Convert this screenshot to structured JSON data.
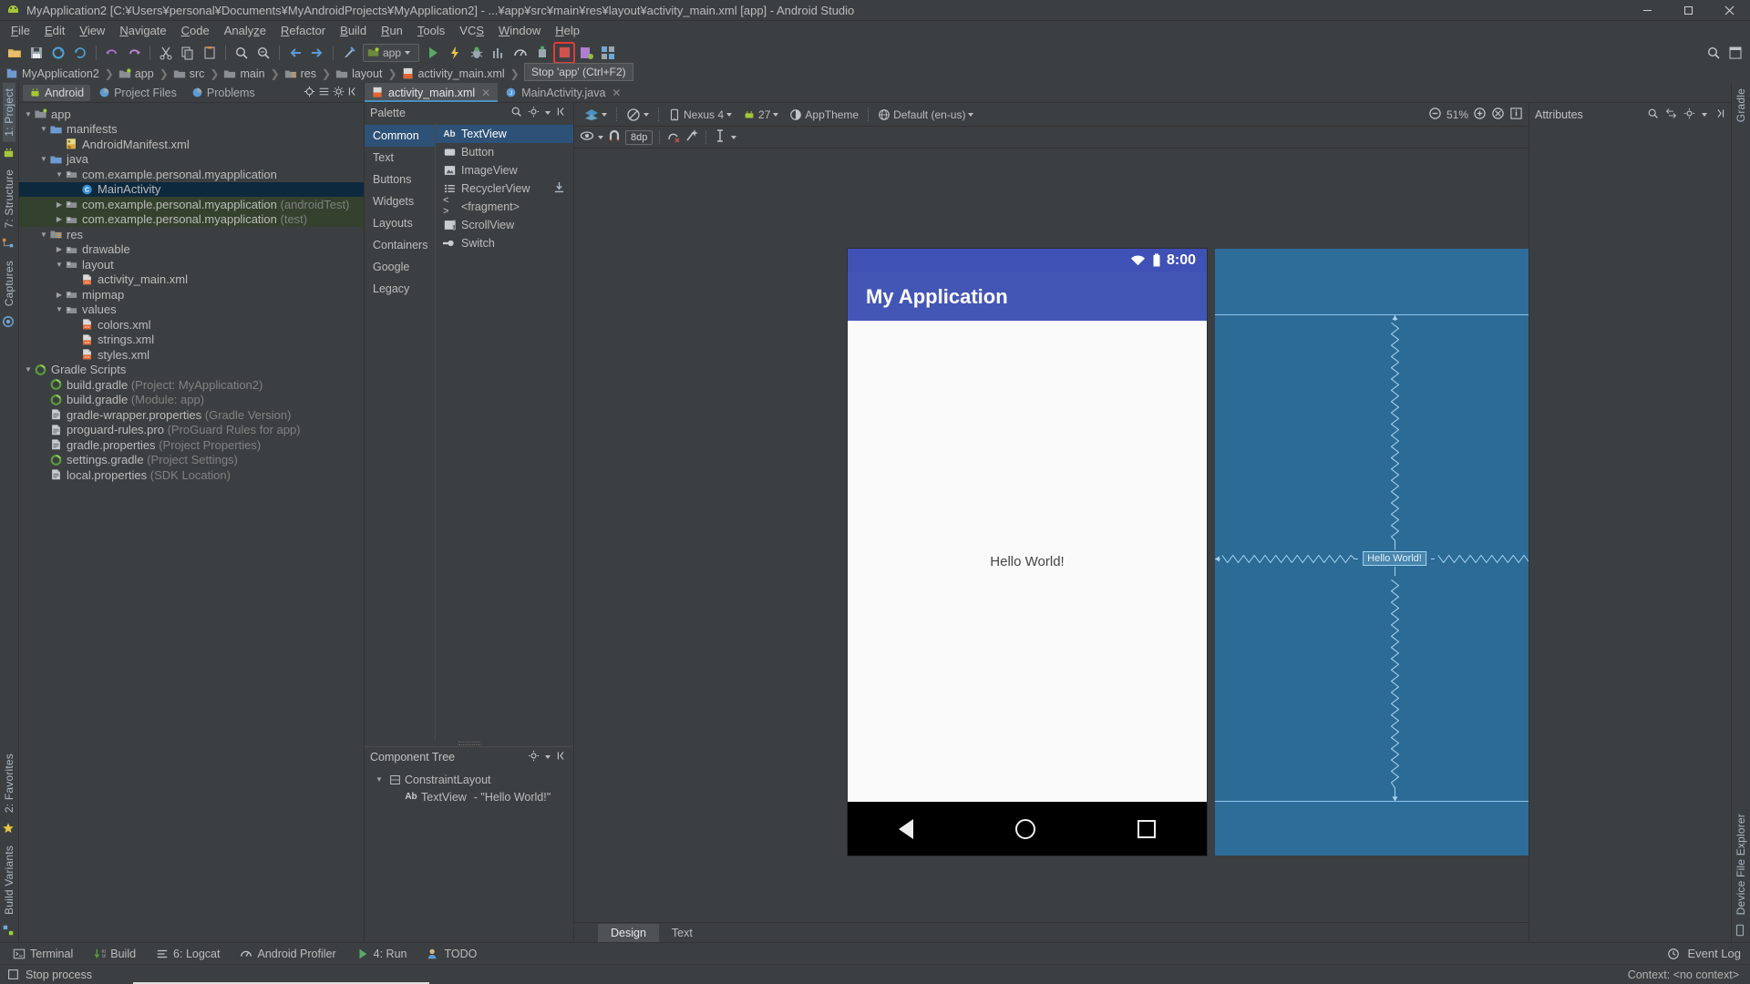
{
  "window": {
    "title": "MyApplication2 [C:¥Users¥personal¥Documents¥MyAndroidProjects¥MyApplication2] - ...¥app¥src¥main¥res¥layout¥activity_main.xml [app] - Android Studio",
    "minimize": "—",
    "maximize": "▢",
    "close": "✕"
  },
  "menu": [
    "File",
    "Edit",
    "View",
    "Navigate",
    "Code",
    "Analyze",
    "Refactor",
    "Build",
    "Run",
    "Tools",
    "VCS",
    "Window",
    "Help"
  ],
  "toolbar": {
    "run_config": "app",
    "tooltip": "Stop 'app' (Ctrl+F2)",
    "icons": [
      "open-folder-icon",
      "save-all-icon",
      "sync-project-icon",
      "refresh-icon",
      "undo-icon",
      "redo-icon",
      "cut-icon",
      "copy-icon",
      "paste-icon",
      "find-icon",
      "replace-icon",
      "back-icon",
      "forward-icon",
      "build-icon",
      "run-icon",
      "apply-changes-icon",
      "debug-icon",
      "profile-icon",
      "attach-debugger-icon",
      "stop-icon",
      "avd-manager-icon",
      "sdk-manager-icon",
      "help-icon"
    ]
  },
  "breadcrumb": [
    "MyApplication2",
    "app",
    "src",
    "main",
    "res",
    "layout",
    "activity_main.xml"
  ],
  "left_strip": {
    "tabs": [
      "1: Project",
      "7: Structure",
      "Captures"
    ],
    "bottom_tabs": [
      "2: Favorites",
      "Build Variants"
    ]
  },
  "right_strip": {
    "tabs": [
      "Gradle",
      "Device File Explorer"
    ]
  },
  "project_panel": {
    "tabs": [
      {
        "label": "Android",
        "icon": "android-icon",
        "active": true
      },
      {
        "label": "Project Files",
        "icon": "project-files-icon",
        "active": false
      },
      {
        "label": "Problems",
        "icon": "problems-icon",
        "active": false
      }
    ],
    "tree": [
      {
        "label": "app",
        "icon": "module-folder-icon",
        "indent": 0,
        "arrow": "down",
        "selected": false
      },
      {
        "label": "manifests",
        "icon": "folder-blue-icon",
        "indent": 1,
        "arrow": "down",
        "selected": false
      },
      {
        "label": "AndroidManifest.xml",
        "icon": "manifest-icon",
        "indent": 2,
        "arrow": "none",
        "selected": false
      },
      {
        "label": "java",
        "icon": "folder-blue-icon",
        "indent": 1,
        "arrow": "down",
        "selected": false
      },
      {
        "label": "com.example.personal.myapplication",
        "icon": "package-icon",
        "indent": 2,
        "arrow": "down",
        "selected": false
      },
      {
        "label": "MainActivity",
        "icon": "class-icon",
        "indent": 3,
        "arrow": "none",
        "selected": true
      },
      {
        "label": "com.example.personal.myapplication",
        "suffix": "(androidTest)",
        "icon": "package-icon",
        "indent": 2,
        "arrow": "right",
        "testbg": true
      },
      {
        "label": "com.example.personal.myapplication",
        "suffix": "(test)",
        "icon": "package-icon",
        "indent": 2,
        "arrow": "right",
        "testbg": true
      },
      {
        "label": "res",
        "icon": "res-folder-icon",
        "indent": 1,
        "arrow": "down",
        "selected": false
      },
      {
        "label": "drawable",
        "icon": "package-icon",
        "indent": 2,
        "arrow": "right",
        "selected": false
      },
      {
        "label": "layout",
        "icon": "package-icon",
        "indent": 2,
        "arrow": "down",
        "selected": false
      },
      {
        "label": "activity_main.xml",
        "icon": "xml-icon",
        "indent": 3,
        "arrow": "none",
        "selected": false
      },
      {
        "label": "mipmap",
        "icon": "package-icon",
        "indent": 2,
        "arrow": "right",
        "selected": false
      },
      {
        "label": "values",
        "icon": "package-icon",
        "indent": 2,
        "arrow": "down",
        "selected": false
      },
      {
        "label": "colors.xml",
        "icon": "xml-icon",
        "indent": 3,
        "arrow": "none",
        "selected": false
      },
      {
        "label": "strings.xml",
        "icon": "xml-icon",
        "indent": 3,
        "arrow": "none",
        "selected": false
      },
      {
        "label": "styles.xml",
        "icon": "xml-icon",
        "indent": 3,
        "arrow": "none",
        "selected": false
      },
      {
        "label": "Gradle Scripts",
        "icon": "gradle-icon",
        "indent": 0,
        "arrow": "down",
        "selected": false
      },
      {
        "label": "build.gradle",
        "suffix": "(Project: MyApplication2)",
        "icon": "gradle-icon",
        "indent": 1,
        "arrow": "none"
      },
      {
        "label": "build.gradle",
        "suffix": "(Module: app)",
        "icon": "gradle-icon",
        "indent": 1,
        "arrow": "none"
      },
      {
        "label": "gradle-wrapper.properties",
        "suffix": "(Gradle Version)",
        "icon": "properties-icon",
        "indent": 1,
        "arrow": "none"
      },
      {
        "label": "proguard-rules.pro",
        "suffix": "(ProGuard Rules for app)",
        "icon": "properties-icon",
        "indent": 1,
        "arrow": "none"
      },
      {
        "label": "gradle.properties",
        "suffix": "(Project Properties)",
        "icon": "properties-icon",
        "indent": 1,
        "arrow": "none"
      },
      {
        "label": "settings.gradle",
        "suffix": "(Project Settings)",
        "icon": "gradle-icon",
        "indent": 1,
        "arrow": "none"
      },
      {
        "label": "local.properties",
        "suffix": "(SDK Location)",
        "icon": "properties-icon",
        "indent": 1,
        "arrow": "none"
      }
    ]
  },
  "editor_tabs": [
    {
      "label": "activity_main.xml",
      "icon": "xml-icon",
      "active": true,
      "close": "✕"
    },
    {
      "label": "MainActivity.java",
      "icon": "java-icon",
      "active": false,
      "close": "✕"
    }
  ],
  "palette": {
    "title": "Palette",
    "categories": [
      "Common",
      "Text",
      "Buttons",
      "Widgets",
      "Layouts",
      "Containers",
      "Google",
      "Legacy"
    ],
    "active_category": "Common",
    "items": [
      {
        "label": "TextView",
        "icon": "ab-icon",
        "active": true,
        "download": false
      },
      {
        "label": "Button",
        "icon": "button-icon",
        "active": false,
        "download": false
      },
      {
        "label": "ImageView",
        "icon": "image-icon",
        "active": false,
        "download": false
      },
      {
        "label": "RecyclerView",
        "icon": "list-icon",
        "active": false,
        "download": true
      },
      {
        "label": "<fragment>",
        "icon": "code-icon",
        "active": false,
        "download": false
      },
      {
        "label": "ScrollView",
        "icon": "scroll-icon",
        "active": false,
        "download": false
      },
      {
        "label": "Switch",
        "icon": "switch-icon",
        "active": false,
        "download": false
      }
    ]
  },
  "component_tree": {
    "title": "Component Tree",
    "nodes": [
      {
        "label": "ConstraintLayout",
        "icon": "constraint-layout-icon",
        "indent": 0,
        "arrow": "down"
      },
      {
        "label": "TextView",
        "suffix": "- \"Hello World!\"",
        "icon": "ab-icon",
        "indent": 1,
        "arrow": "none"
      }
    ]
  },
  "design_toolbar": {
    "device": "Nexus 4",
    "api_level": "27",
    "theme": "AppTheme",
    "locale": "Default (en-us)",
    "zoom": "51%",
    "attributes_title": "Attributes",
    "margin": "8dp"
  },
  "preview": {
    "status_time": "8:00",
    "app_title": "My Application",
    "hello_text": "Hello World!",
    "blueprint_label": "Hello World!"
  },
  "bottom_tabs": [
    {
      "label": "Design",
      "active": true
    },
    {
      "label": "Text",
      "active": false
    }
  ],
  "bottom_bar": {
    "items": [
      {
        "label": "Terminal",
        "icon": "terminal-icon"
      },
      {
        "label": "Build",
        "icon": "build-icon"
      },
      {
        "label": "6: Logcat",
        "icon": "logcat-icon"
      },
      {
        "label": "Android Profiler",
        "icon": "profiler-icon"
      },
      {
        "label": "4: Run",
        "icon": "run-icon"
      },
      {
        "label": "TODO",
        "icon": "todo-icon"
      }
    ],
    "event_log": "Event Log"
  },
  "status_bar": {
    "message": "Stop process",
    "context": "Context: <no context>"
  },
  "colors": {
    "accent_blue": "#2d5177",
    "selection": "#0d293e",
    "appbar": "#4456b5",
    "statusbar": "#3f51b5",
    "blueprint": "#2c6b96",
    "stop_red": "#e53935",
    "panel_bg": "#3c3f41"
  }
}
